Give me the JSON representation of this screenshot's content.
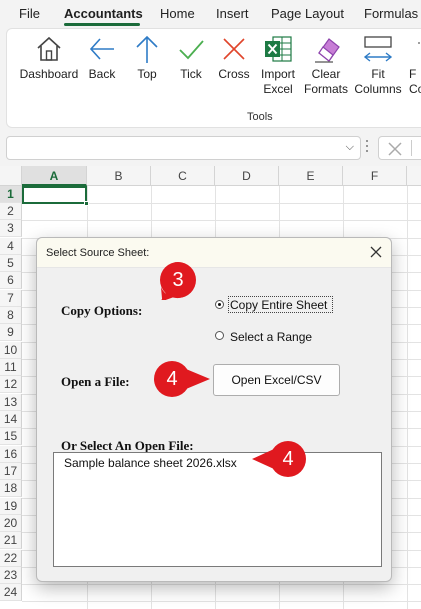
{
  "ribbon_tabs": [
    "File",
    "Accountants",
    "Home",
    "Insert",
    "Page Layout",
    "Formulas"
  ],
  "active_tab": "Accountants",
  "ribbon": {
    "group_label": "Tools",
    "buttons": [
      {
        "line1": "Dashboard",
        "line2": "",
        "icon": "house-icon"
      },
      {
        "line1": "Back",
        "line2": "",
        "icon": "arrow-left-icon"
      },
      {
        "line1": "Top",
        "line2": "",
        "icon": "arrow-up-icon"
      },
      {
        "line1": "Tick",
        "line2": "",
        "icon": "checkmark-icon"
      },
      {
        "line1": "Cross",
        "line2": "",
        "icon": "cross-icon"
      },
      {
        "line1": "Import",
        "line2": "Excel",
        "icon": "excel-icon"
      },
      {
        "line1": "Clear",
        "line2": "Formats",
        "icon": "eraser-icon"
      },
      {
        "line1": "Fit",
        "line2": "Columns",
        "icon": "fit-columns-icon"
      },
      {
        "line1": "F",
        "line2": "Co",
        "icon": "partial-icon"
      }
    ]
  },
  "formula_bar": {
    "namebox_value": "",
    "chevron": "⌵"
  },
  "grid": {
    "columns": [
      "A",
      "B",
      "C",
      "D",
      "E",
      "F"
    ],
    "selected_column": "A",
    "rows": [
      "1",
      "2",
      "3",
      "4",
      "5",
      "6",
      "7",
      "8",
      "9",
      "10",
      "11",
      "12",
      "13",
      "14",
      "15",
      "16",
      "17",
      "18",
      "19",
      "20",
      "21",
      "22",
      "23",
      "24"
    ],
    "selected_row": "1",
    "active_cell": "A1"
  },
  "dialog": {
    "title": "Select Source Sheet:",
    "close_glyph": "✕",
    "copy_options_label": "Copy Options:",
    "radio_entire": "Copy Entire Sheet",
    "radio_range": "Select a Range",
    "selected_option": "Copy Entire Sheet",
    "open_file_label": "Open a File:",
    "open_button": "Open Excel/CSV",
    "open_files_label": "Or Select An Open File:",
    "open_files": [
      "Sample balance sheet 2026.xlsx"
    ]
  },
  "callouts": [
    "3",
    "4",
    "4"
  ],
  "colors": {
    "accent": "#1b6b3a",
    "callout": "#e0191f",
    "dialog_bg": "#f0f0f0",
    "title_bg": "#fbfaf0",
    "icon_blue": "#2e7bc6"
  }
}
